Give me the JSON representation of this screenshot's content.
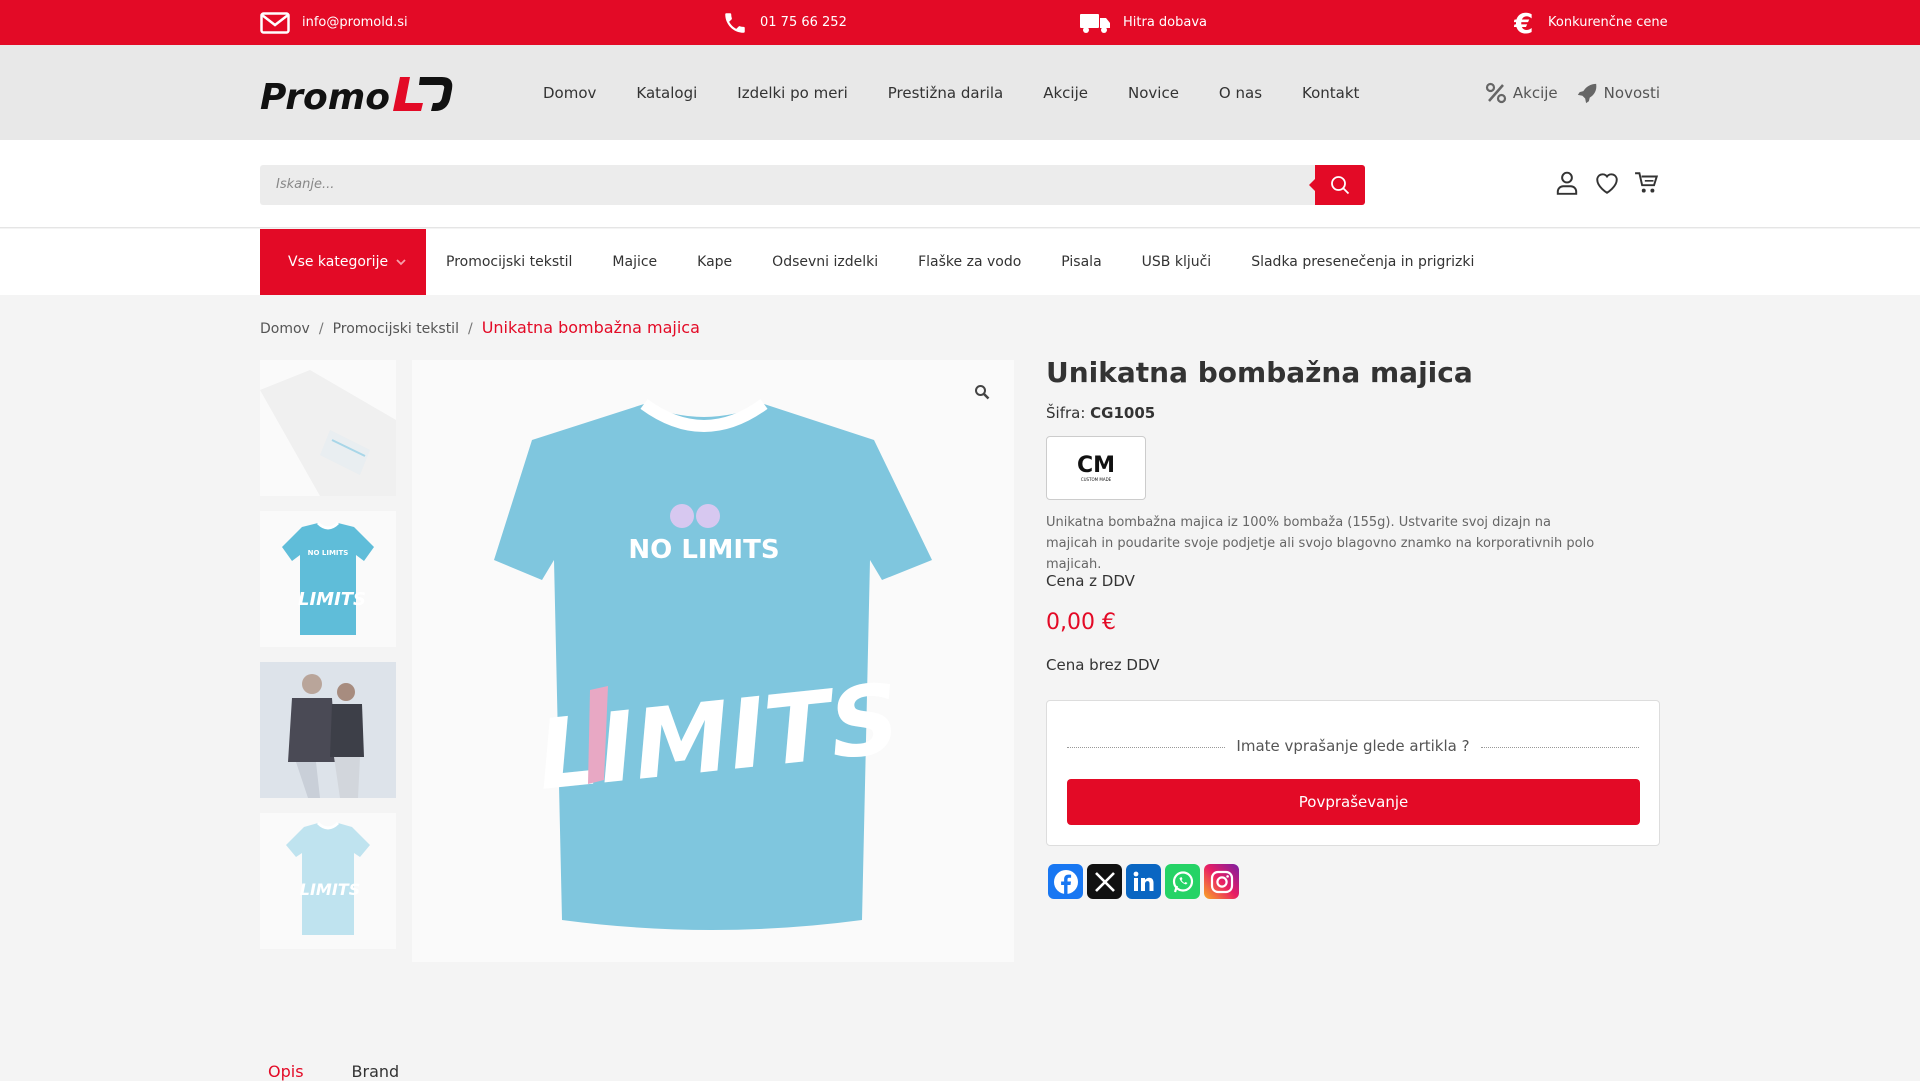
{
  "topbar": {
    "email": "info@promold.si",
    "phone": "01 75 66 252",
    "delivery": "Hitra dobava",
    "prices": "Konkurenčne cene"
  },
  "header": {
    "logo_text": "Promo LD",
    "nav": [
      "Domov",
      "Katalogi",
      "Izdelki po meri",
      "Prestižna darila",
      "Akcije",
      "Novice",
      "O nas",
      "Kontakt"
    ],
    "quick_links": {
      "sales": "Akcije",
      "news": "Novosti"
    }
  },
  "search": {
    "placeholder": "Iskanje..."
  },
  "categories": {
    "all_label": "Vse kategorije",
    "items": [
      "Promocijski tekstil",
      "Majice",
      "Kape",
      "Odsevni izdelki",
      "Flaške za vodo",
      "Pisala",
      "USB ključi",
      "Sladka presenečenja in prigrizki"
    ]
  },
  "breadcrumb": {
    "home": "Domov",
    "category": "Promocijski tekstil",
    "current": "Unikatna bombažna majica"
  },
  "product": {
    "title": "Unikatna bombažna majica",
    "sku_label": "Šifra:",
    "sku": "CG1005",
    "brand_logo": "CM",
    "brand_sub": "CUSTOM MADE",
    "description": "Unikatna bombažna majica iz 100% bombaža (155g). Ustvarite svoj dizajn na majicah in poudarite svoje podjetje ali svojo blagovno znamko na korporativnih polo majicah.",
    "price_with_vat_label": "Cena z DDV",
    "price": "0,00 €",
    "price_without_vat_label": "Cena brez DDV",
    "shirt_text_chest": "NO LIMITS",
    "shirt_text_big": "LIMITS"
  },
  "inquiry": {
    "question": "Imate vprašanje glede artikla ?",
    "button": "Povpraševanje"
  },
  "tabs": [
    "Opis",
    "Brand"
  ],
  "colors": {
    "accent": "#e30a26",
    "shirt": "#5fbdd9"
  }
}
